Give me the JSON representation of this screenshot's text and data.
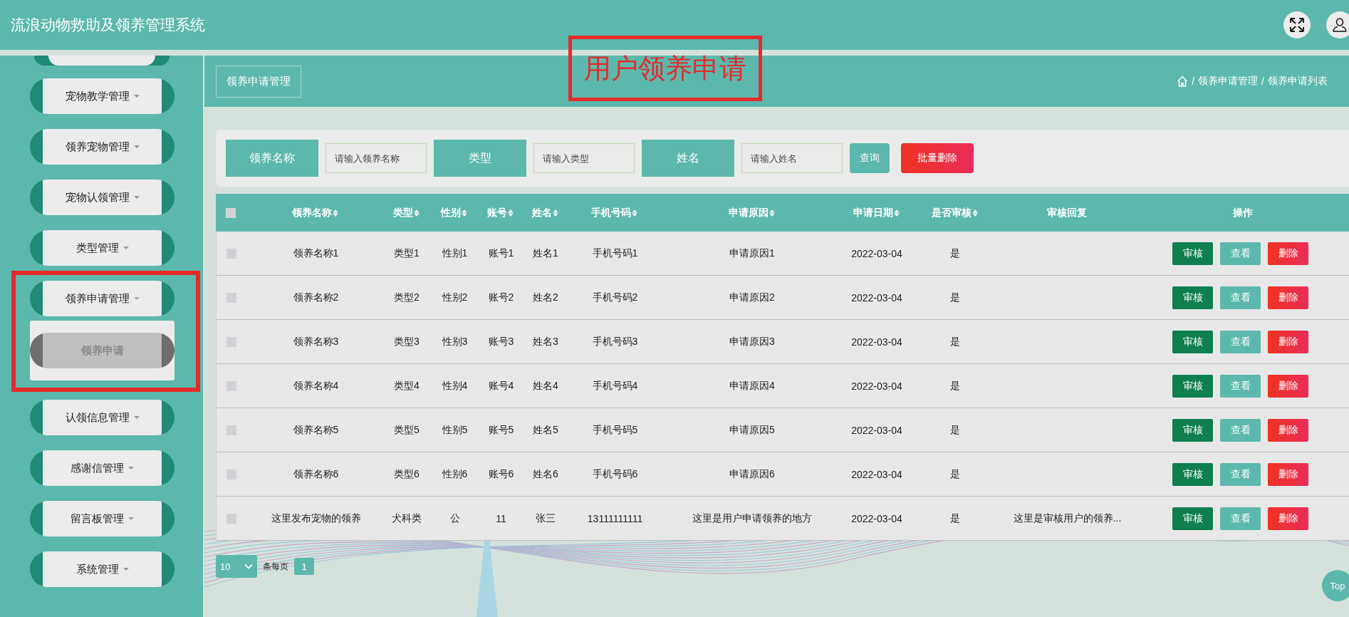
{
  "header": {
    "title": "流浪动物救助及领养管理系统"
  },
  "annotation": {
    "label": "用户领养申请"
  },
  "sidebar": {
    "items": [
      {
        "label": "宠物教学管理",
        "expanded": false
      },
      {
        "label": "领养宠物管理",
        "expanded": false
      },
      {
        "label": "宠物认领管理",
        "expanded": false
      },
      {
        "label": "类型管理",
        "expanded": false
      },
      {
        "label": "领养申请管理",
        "expanded": true,
        "highlighted": true,
        "children": [
          {
            "label": "领养申请",
            "selected": true
          }
        ]
      },
      {
        "label": "认领信息管理",
        "expanded": false
      },
      {
        "label": "感谢信管理",
        "expanded": false
      },
      {
        "label": "留言板管理",
        "expanded": false
      },
      {
        "label": "系统管理",
        "expanded": false
      }
    ]
  },
  "page_title": "领养申请管理",
  "breadcrumb": [
    {
      "separator": "/",
      "label": "领养申请管理"
    },
    {
      "separator": "/",
      "label": "领养申请列表"
    }
  ],
  "search": {
    "fields": [
      {
        "label": "领养名称",
        "placeholder": "请输入领养名称"
      },
      {
        "label": "类型",
        "placeholder": "请输入类型"
      },
      {
        "label": "姓名",
        "placeholder": "请输入姓名"
      }
    ],
    "query_button": "查询",
    "batch_delete_button": "批量删除"
  },
  "table": {
    "select_all": false,
    "columns": [
      {
        "label": "领养名称",
        "sortable": true
      },
      {
        "label": "类型",
        "sortable": true
      },
      {
        "label": "性别",
        "sortable": true
      },
      {
        "label": "账号",
        "sortable": true
      },
      {
        "label": "姓名",
        "sortable": true
      },
      {
        "label": "手机号码",
        "sortable": true
      },
      {
        "label": "申请原因",
        "sortable": true
      },
      {
        "label": "申请日期",
        "sortable": true
      },
      {
        "label": "是否审核",
        "sortable": true
      },
      {
        "label": "审核回复",
        "sortable": false
      },
      {
        "label": "操作",
        "sortable": false
      }
    ],
    "rows": [
      {
        "checked": false,
        "cells": [
          "领养名称1",
          "类型1",
          "性别1",
          "账号1",
          "姓名1",
          "手机号码1",
          "申请原因1",
          "2022-03-04",
          "是",
          ""
        ],
        "actions": [
          "审核",
          "查看",
          "删除"
        ]
      },
      {
        "checked": false,
        "cells": [
          "领养名称2",
          "类型2",
          "性别2",
          "账号2",
          "姓名2",
          "手机号码2",
          "申请原因2",
          "2022-03-04",
          "是",
          ""
        ],
        "actions": [
          "审核",
          "查看",
          "删除"
        ]
      },
      {
        "checked": false,
        "cells": [
          "领养名称3",
          "类型3",
          "性别3",
          "账号3",
          "姓名3",
          "手机号码3",
          "申请原因3",
          "2022-03-04",
          "是",
          ""
        ],
        "actions": [
          "审核",
          "查看",
          "删除"
        ]
      },
      {
        "checked": false,
        "cells": [
          "领养名称4",
          "类型4",
          "性别4",
          "账号4",
          "姓名4",
          "手机号码4",
          "申请原因4",
          "2022-03-04",
          "是",
          ""
        ],
        "actions": [
          "审核",
          "查看",
          "删除"
        ]
      },
      {
        "checked": false,
        "cells": [
          "领养名称5",
          "类型5",
          "性别5",
          "账号5",
          "姓名5",
          "手机号码5",
          "申请原因5",
          "2022-03-04",
          "是",
          ""
        ],
        "actions": [
          "审核",
          "查看",
          "删除"
        ]
      },
      {
        "checked": false,
        "cells": [
          "领养名称6",
          "类型6",
          "性别6",
          "账号6",
          "姓名6",
          "手机号码6",
          "申请原因6",
          "2022-03-04",
          "是",
          ""
        ],
        "actions": [
          "审核",
          "查看",
          "删除"
        ]
      },
      {
        "checked": false,
        "cells": [
          "这里发布宠物的领养",
          "犬科类",
          "公",
          "11",
          "张三",
          "13111111111",
          "这里是用户申请领养的地方",
          "2022-03-04",
          "是",
          "这里是审核用户的领养..."
        ],
        "actions": [
          "审核",
          "查看",
          "删除"
        ]
      }
    ]
  },
  "pagination": {
    "page_size": "10",
    "page_size_label": "条每页",
    "pages": [
      {
        "label": "1",
        "selected": true
      }
    ]
  },
  "top_button": "Top"
}
